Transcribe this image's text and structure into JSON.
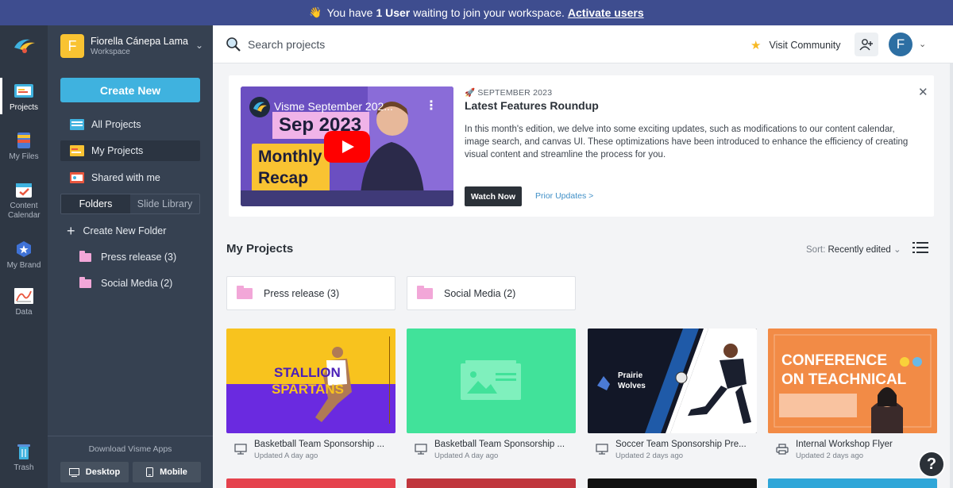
{
  "banner": {
    "prefix": "You have",
    "count_text": "1 User",
    "suffix": "waiting to join your workspace.",
    "link": "Activate users"
  },
  "rail": {
    "items": [
      {
        "label": "Projects",
        "icon": "projects-icon"
      },
      {
        "label": "My Files",
        "icon": "files-icon"
      },
      {
        "label": "Content Calendar",
        "icon": "calendar-icon"
      },
      {
        "label": "My Brand",
        "icon": "brand-icon"
      },
      {
        "label": "Data",
        "icon": "data-icon"
      },
      {
        "label": "Trash",
        "icon": "trash-icon"
      }
    ]
  },
  "workspace": {
    "initial": "F",
    "name": "Fiorella Cánepa Lama",
    "subtitle": "Workspace"
  },
  "sidebar": {
    "create_label": "Create New",
    "nav": [
      {
        "label": "All Projects"
      },
      {
        "label": "My Projects"
      },
      {
        "label": "Shared with me"
      }
    ],
    "tabs": [
      "Folders",
      "Slide Library"
    ],
    "create_folder": "Create New Folder",
    "folders": [
      {
        "label": "Press release (3)"
      },
      {
        "label": "Social Media (2)"
      }
    ],
    "download_label": "Download Visme Apps",
    "desktop_label": "Desktop",
    "mobile_label": "Mobile"
  },
  "topbar": {
    "search_placeholder": "Search projects",
    "visit_label": "Visit Community",
    "avatar_initial": "F"
  },
  "promo": {
    "video_title": "Visme September 202...",
    "video_lines": [
      "Sep 2023",
      "Monthly",
      "Recap"
    ],
    "date": "SEPTEMBER 2023",
    "title": "Latest Features Roundup",
    "body": "In this month's edition, we delve into some exciting updates, such as modifications to our content calendar, image search, and canvas UI. These optimizations have been introduced to enhance the efficiency of creating visual content and streamline the process for you.",
    "watch_label": "Watch Now",
    "prior_label": "Prior Updates >"
  },
  "projects": {
    "heading": "My Projects",
    "sort_prefix": "Sort:",
    "sort_value": "Recently edited",
    "folders": [
      {
        "label": "Press release  (3)"
      },
      {
        "label": "Social Media  (2)"
      }
    ],
    "cards": [
      {
        "title": "Basketball Team Sponsorship ...",
        "updated": "Updated A day ago",
        "thumb_text": [
          "STALLION",
          "SPARTANS"
        ],
        "type_icon": "presentation-icon"
      },
      {
        "title": "Basketball Team Sponsorship ...",
        "updated": "Updated A day ago",
        "thumb_text": [],
        "type_icon": "presentation-icon"
      },
      {
        "title": "Soccer Team Sponsorship Pre...",
        "updated": "Updated 2 days ago",
        "thumb_text": [
          "Prairie",
          "Wolves"
        ],
        "type_icon": "presentation-icon"
      },
      {
        "title": "Internal Workshop Flyer",
        "updated": "Updated 2 days ago",
        "thumb_text": [
          "CONFERENCE",
          "ON TEACHNICAL"
        ],
        "type_icon": "print-icon"
      }
    ]
  },
  "colors": {
    "banner": "#3e4d8f",
    "rail": "#2e3744",
    "sidebar": "#364151",
    "accent": "#3fb2df",
    "folder": "#f2a7d8"
  }
}
